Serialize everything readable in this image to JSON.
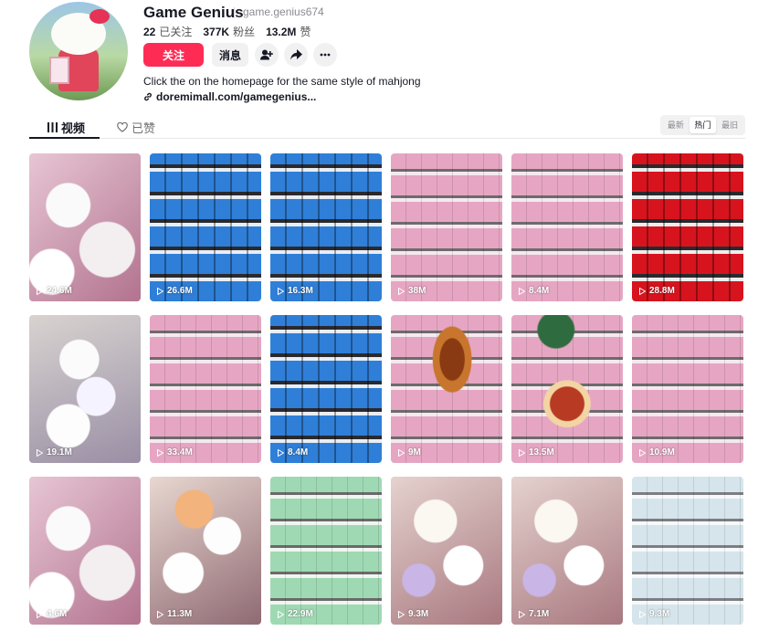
{
  "profile": {
    "name": "Game Genius",
    "handle": "game.genius674",
    "stats": [
      {
        "value": "22",
        "label": "已关注"
      },
      {
        "value": "377K",
        "label": "粉丝"
      },
      {
        "value": "13.2M",
        "label": "赞"
      }
    ],
    "follow_label": "关注",
    "message_label": "消息",
    "bio": "Click the on the homepage for the same style of mahjong",
    "link": "doremimall.com/gamegenius..."
  },
  "tabs": {
    "videos": "视频",
    "liked": "已赞"
  },
  "sort": {
    "latest": "最新",
    "popular": "热门",
    "oldest": "最旧",
    "active": "popular"
  },
  "videos": [
    {
      "views": "24.6M",
      "thumb": "t-hk"
    },
    {
      "views": "26.6M",
      "thumb": "t-blue"
    },
    {
      "views": "16.3M",
      "thumb": "t-blue"
    },
    {
      "views": "38M",
      "thumb": "t-pink"
    },
    {
      "views": "8.4M",
      "thumb": "t-pink"
    },
    {
      "views": "28.8M",
      "thumb": "t-red"
    },
    {
      "views": "19.1M",
      "thumb": "t-stack"
    },
    {
      "views": "33.4M",
      "thumb": "t-pink"
    },
    {
      "views": "8.4M",
      "thumb": "t-blue"
    },
    {
      "views": "9M",
      "thumb": "t-wheel"
    },
    {
      "views": "13.5M",
      "thumb": "t-wheel2"
    },
    {
      "views": "10.9M",
      "thumb": "t-pink"
    },
    {
      "views": "4.6M",
      "thumb": "t-hk"
    },
    {
      "views": "11.3M",
      "thumb": "t-face"
    },
    {
      "views": "22.9M",
      "thumb": "t-green"
    },
    {
      "views": "9.3M",
      "thumb": "t-mix"
    },
    {
      "views": "7.1M",
      "thumb": "t-mix"
    },
    {
      "views": "9.3M",
      "thumb": "t-ice"
    }
  ]
}
